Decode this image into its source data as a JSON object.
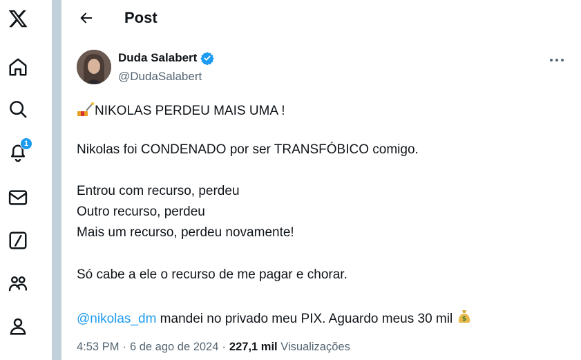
{
  "nav": {
    "notification_count": "1"
  },
  "header": {
    "title": "Post"
  },
  "post": {
    "author_name": "Duda Salabert",
    "author_handle": "@DudaSalabert",
    "lines": {
      "l1": "NIKOLAS PERDEU MAIS UMA !",
      "l2": "Nikolas foi CONDENADO por ser TRANSFÓBICO comigo.",
      "l3": "Entrou com recurso, perdeu",
      "l4": "Outro recurso, perdeu",
      "l5": "Mais um recurso, perdeu novamente!",
      "l6": "Só cabe a ele o recurso de me pagar e chorar.",
      "mention": "@nikolas_dm",
      "l7": " mandei no privado meu PIX. Aguardo meus 30 mil "
    },
    "time": "4:53 PM",
    "separator": "·",
    "date": "6 de ago de 2024",
    "views_count": "227,1 mil",
    "views_label": "Visualizações"
  }
}
